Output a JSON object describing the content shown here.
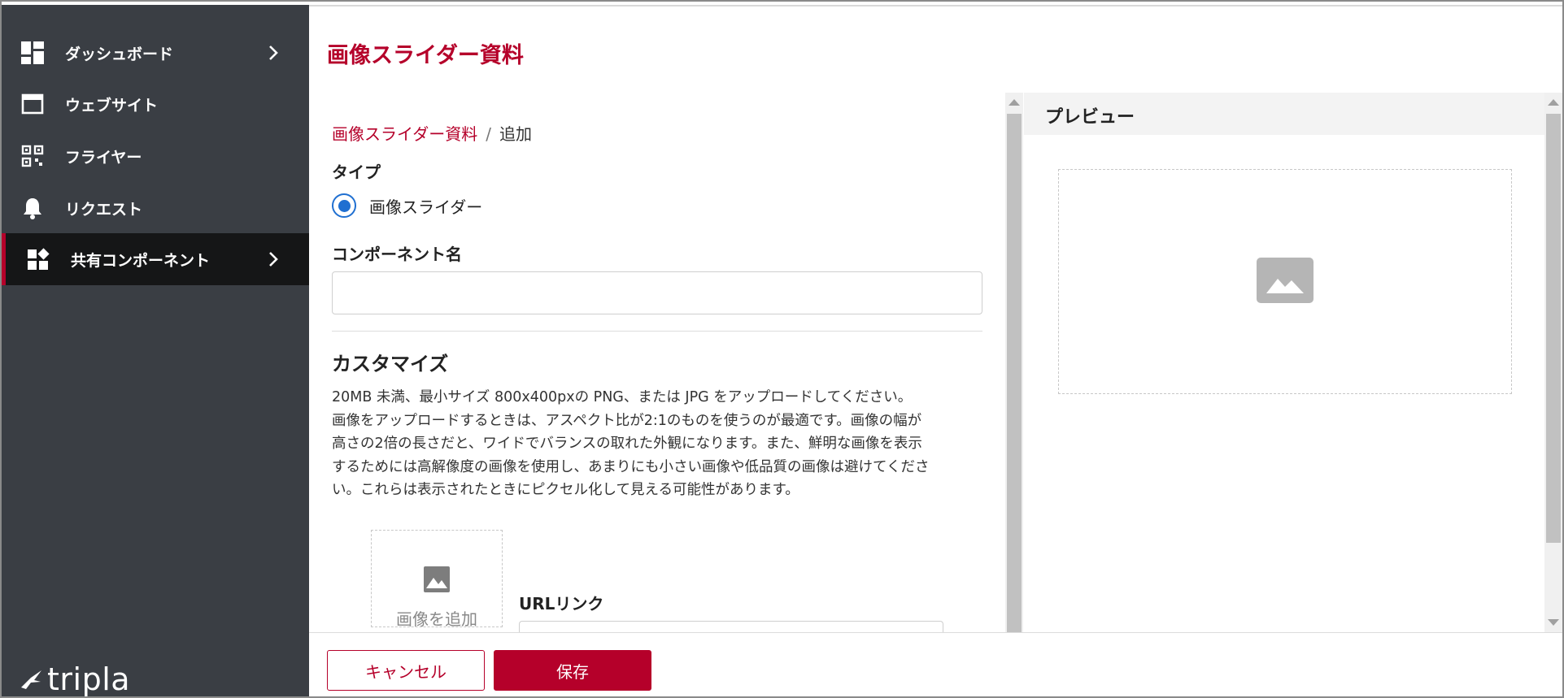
{
  "sidebar": {
    "items": [
      {
        "label": "ダッシュボード",
        "icon": "dashboard-icon",
        "has_chevron": true,
        "active": false
      },
      {
        "label": "ウェブサイト",
        "icon": "browser-window-icon",
        "has_chevron": false,
        "active": false
      },
      {
        "label": "フライヤー",
        "icon": "qr-code-icon",
        "has_chevron": false,
        "active": false
      },
      {
        "label": "リクエスト",
        "icon": "bell-icon",
        "has_chevron": false,
        "active": false
      },
      {
        "label": "共有コンポーネント",
        "icon": "widgets-icon",
        "has_chevron": true,
        "active": true
      }
    ],
    "logo_text": "tripla"
  },
  "header": {
    "title": "画像スライダー資料"
  },
  "breadcrumb": {
    "parent": "画像スライダー資料",
    "separator": "/",
    "current": "追加"
  },
  "form": {
    "type_label": "タイプ",
    "type_option": "画像スライダー",
    "type_selected": true,
    "name_label": "コンポーネント名",
    "name_value": "",
    "customize_label": "カスタマイズ",
    "description_lines": [
      "20MB 未満、最小サイズ 800x400pxの PNG、または JPG をアップロードしてください。",
      "画像をアップロードするときは、アスペクト比が2:1のものを使うのが最適です。画像の幅が",
      "高さの2倍の長さだと、ワイドでバランスの取れた外観になります。また、鮮明な画像を表示",
      "するためには高解像度の画像を使用し、あまりにも小さい画像や低品質の画像は避けてくださ",
      "い。これらは表示されたときにピクセル化して見える可能性があります。"
    ],
    "add_image_label": "画像を追加",
    "url_label": "URLリンク",
    "url_value": ""
  },
  "preview": {
    "title": "プレビュー"
  },
  "actions": {
    "cancel_label": "キャンセル",
    "save_label": "保存"
  },
  "colors": {
    "accent": "#b5002a",
    "sidebar_bg": "#3a3e44",
    "sidebar_active_bg": "#151617",
    "radio_blue": "#1f6fd1"
  }
}
